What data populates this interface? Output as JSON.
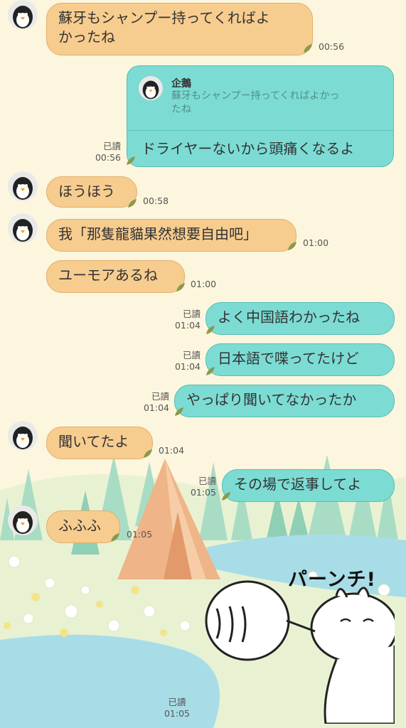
{
  "messages": [
    {
      "text_line1": "蘇牙もシャンプー持ってくればよ",
      "text_line2": "かったね",
      "time": "00:56"
    },
    {
      "reply_name": "企鵝",
      "reply_line1": "蘇牙もシャンプー持ってくればよかっ",
      "reply_line2": "たね",
      "text": "ドライヤーないから頭痛くなるよ",
      "read": "已讀",
      "time": "00:56"
    },
    {
      "text": "ほうほう",
      "time": "00:58"
    },
    {
      "text": "我「那隻龍貓果然想要自由吧」",
      "time": "01:00"
    },
    {
      "text": "ユーモアあるね",
      "time": "01:00"
    },
    {
      "text": "よく中国語わかったね",
      "read": "已讀",
      "time": "01:04"
    },
    {
      "text": "日本語で喋ってたけど",
      "read": "已讀",
      "time": "01:04"
    },
    {
      "text": "やっぱり聞いてなかったか",
      "read": "已讀",
      "time": "01:04"
    },
    {
      "text": "聞いてたよ",
      "time": "01:04"
    },
    {
      "text": "その場で返事してよ",
      "read": "已讀",
      "time": "01:05"
    },
    {
      "text": "ふふふ",
      "time": "01:05"
    }
  ],
  "sticker": {
    "caption": "パーンチ!",
    "read": "已讀",
    "time": "01:05"
  },
  "colors": {
    "incoming": "#f7cc8f",
    "outgoing": "#7cdcd4",
    "background": "#fbf6dd"
  },
  "icons": {
    "avatar": "penguin-icon",
    "leaf": "leaf-icon"
  }
}
